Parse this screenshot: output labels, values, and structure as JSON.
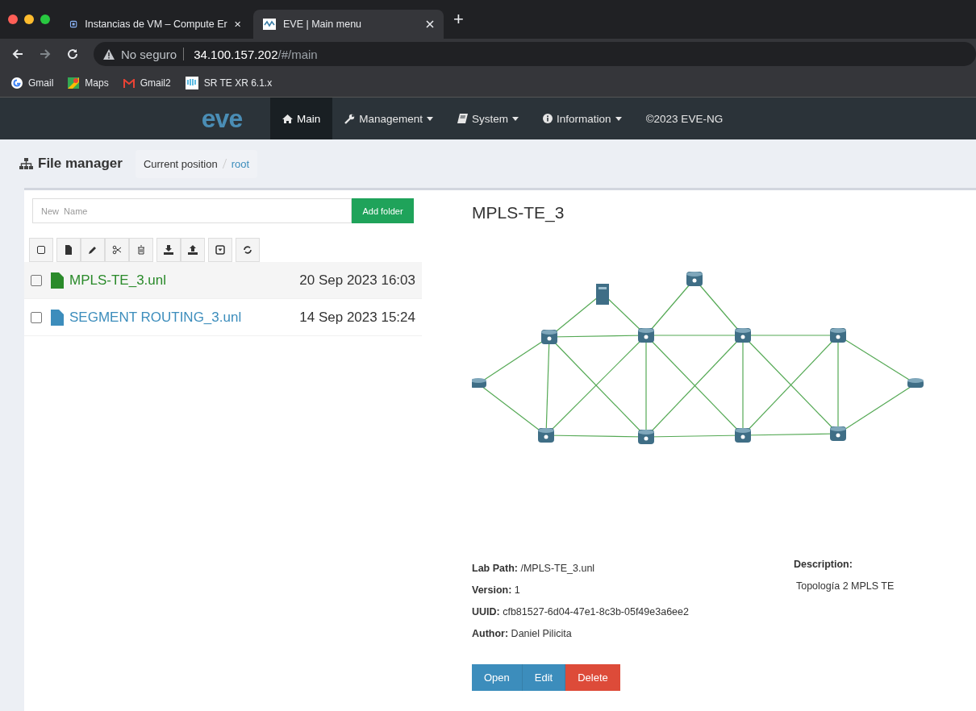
{
  "browser": {
    "tabs": [
      {
        "title": "Instancias de VM – Compute Er",
        "selected": false
      },
      {
        "title": "EVE | Main menu",
        "selected": true
      }
    ],
    "new_tab": "+",
    "address": {
      "security": "No seguro",
      "host": "34.100.157.202",
      "path": "/#/main"
    },
    "bookmarks": [
      {
        "label": "Gmail"
      },
      {
        "label": "Maps"
      },
      {
        "label": "Gmail2"
      },
      {
        "label": "SR TE XR 6.1.x"
      }
    ]
  },
  "navbar": {
    "logo": "eve",
    "items": [
      {
        "label": "Main",
        "dropdown": false,
        "selected": true
      },
      {
        "label": "Management",
        "dropdown": true,
        "selected": false
      },
      {
        "label": "System",
        "dropdown": true,
        "selected": false
      },
      {
        "label": "Information",
        "dropdown": true,
        "selected": false
      }
    ],
    "copyright": "©2023 EVE-NG"
  },
  "file_manager": {
    "title": "File manager",
    "breadcrumb": {
      "label": "Current position",
      "current": "root"
    },
    "new_name": {
      "placeholder": "New  Name"
    },
    "add_button": "Add folder",
    "files": [
      {
        "name": "MPLS-TE_3.unl",
        "date": "20 Sep 2023 16:03",
        "checked": false,
        "selected": true
      },
      {
        "name": "SEGMENT ROUTING_3.unl",
        "date": "14 Sep 2023 15:24",
        "checked": false,
        "selected": false
      }
    ]
  },
  "lab": {
    "title": "MPLS-TE_3",
    "details": [
      {
        "label": "Lab Path:",
        "value": "/MPLS-TE_3.unl"
      },
      {
        "label": "Version:",
        "value": "1"
      },
      {
        "label": "UUID:",
        "value": "cfb81527-6d04-47e1-8c3b-05f49e3a6ee2"
      },
      {
        "label": "Author:",
        "value": "Daniel Pilicita"
      }
    ],
    "description": {
      "label": "Description:",
      "value": "Topología 2 MPLS TE"
    },
    "buttons": [
      {
        "label": "Open",
        "kind": "primary"
      },
      {
        "label": "Edit",
        "kind": "primary"
      },
      {
        "label": "Delete",
        "kind": "danger"
      }
    ]
  }
}
